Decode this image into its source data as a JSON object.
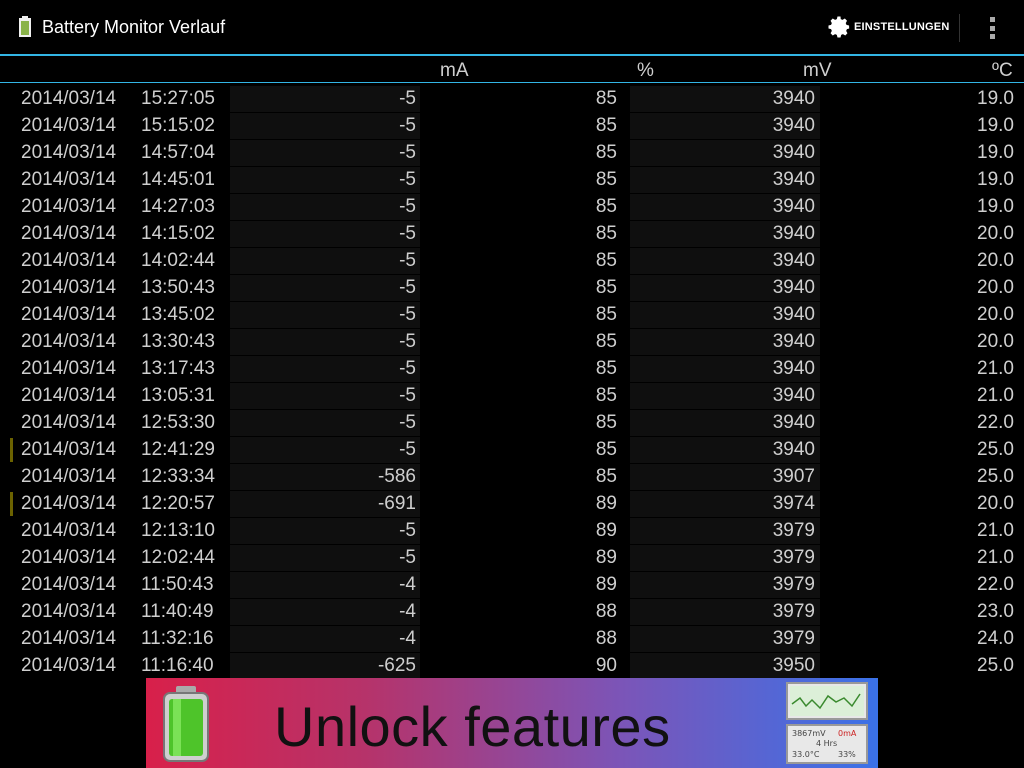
{
  "app": {
    "title": "Battery Monitor Verlauf"
  },
  "actionbar": {
    "settings_label": "EINSTELLUNGEN",
    "settings_icon": "gear-icon",
    "overflow_icon": "overflow-menu-icon"
  },
  "columns": {
    "ma": "mA",
    "percent": "%",
    "mv": "mV",
    "temp": "ºC"
  },
  "rows": [
    {
      "date": "2014/03/14",
      "time": "15:27:05",
      "ma": "-5",
      "percent": "85",
      "mv": "3940",
      "temp": "19.0",
      "marker": false
    },
    {
      "date": "2014/03/14",
      "time": "15:15:02",
      "ma": "-5",
      "percent": "85",
      "mv": "3940",
      "temp": "19.0",
      "marker": false
    },
    {
      "date": "2014/03/14",
      "time": "14:57:04",
      "ma": "-5",
      "percent": "85",
      "mv": "3940",
      "temp": "19.0",
      "marker": false
    },
    {
      "date": "2014/03/14",
      "time": "14:45:01",
      "ma": "-5",
      "percent": "85",
      "mv": "3940",
      "temp": "19.0",
      "marker": false
    },
    {
      "date": "2014/03/14",
      "time": "14:27:03",
      "ma": "-5",
      "percent": "85",
      "mv": "3940",
      "temp": "19.0",
      "marker": false
    },
    {
      "date": "2014/03/14",
      "time": "14:15:02",
      "ma": "-5",
      "percent": "85",
      "mv": "3940",
      "temp": "20.0",
      "marker": false
    },
    {
      "date": "2014/03/14",
      "time": "14:02:44",
      "ma": "-5",
      "percent": "85",
      "mv": "3940",
      "temp": "20.0",
      "marker": false
    },
    {
      "date": "2014/03/14",
      "time": "13:50:43",
      "ma": "-5",
      "percent": "85",
      "mv": "3940",
      "temp": "20.0",
      "marker": false
    },
    {
      "date": "2014/03/14",
      "time": "13:45:02",
      "ma": "-5",
      "percent": "85",
      "mv": "3940",
      "temp": "20.0",
      "marker": false
    },
    {
      "date": "2014/03/14",
      "time": "13:30:43",
      "ma": "-5",
      "percent": "85",
      "mv": "3940",
      "temp": "20.0",
      "marker": false
    },
    {
      "date": "2014/03/14",
      "time": "13:17:43",
      "ma": "-5",
      "percent": "85",
      "mv": "3940",
      "temp": "21.0",
      "marker": false
    },
    {
      "date": "2014/03/14",
      "time": "13:05:31",
      "ma": "-5",
      "percent": "85",
      "mv": "3940",
      "temp": "21.0",
      "marker": false
    },
    {
      "date": "2014/03/14",
      "time": "12:53:30",
      "ma": "-5",
      "percent": "85",
      "mv": "3940",
      "temp": "22.0",
      "marker": false
    },
    {
      "date": "2014/03/14",
      "time": "12:41:29",
      "ma": "-5",
      "percent": "85",
      "mv": "3940",
      "temp": "25.0",
      "marker": true
    },
    {
      "date": "2014/03/14",
      "time": "12:33:34",
      "ma": "-586",
      "percent": "85",
      "mv": "3907",
      "temp": "25.0",
      "marker": false
    },
    {
      "date": "2014/03/14",
      "time": "12:20:57",
      "ma": "-691",
      "percent": "89",
      "mv": "3974",
      "temp": "20.0",
      "marker": true
    },
    {
      "date": "2014/03/14",
      "time": "12:13:10",
      "ma": "-5",
      "percent": "89",
      "mv": "3979",
      "temp": "21.0",
      "marker": false
    },
    {
      "date": "2014/03/14",
      "time": "12:02:44",
      "ma": "-5",
      "percent": "89",
      "mv": "3979",
      "temp": "21.0",
      "marker": false
    },
    {
      "date": "2014/03/14",
      "time": "11:50:43",
      "ma": "-4",
      "percent": "89",
      "mv": "3979",
      "temp": "22.0",
      "marker": false
    },
    {
      "date": "2014/03/14",
      "time": "11:40:49",
      "ma": "-4",
      "percent": "88",
      "mv": "3979",
      "temp": "23.0",
      "marker": false
    },
    {
      "date": "2014/03/14",
      "time": "11:32:16",
      "ma": "-4",
      "percent": "88",
      "mv": "3979",
      "temp": "24.0",
      "marker": false
    },
    {
      "date": "2014/03/14",
      "time": "11:16:40",
      "ma": "-625",
      "percent": "90",
      "mv": "3950",
      "temp": "25.0",
      "marker": false
    }
  ],
  "banner": {
    "text": "Unlock features",
    "battery_icon": "battery-charging-icon",
    "thumb1_icon": "graph-thumbnail-icon",
    "thumb2": {
      "line1_left": "3867mV",
      "line1_right": "0mA",
      "line2": "4 Hrs",
      "line3_left": "33.0°C",
      "line3_right": "33%"
    },
    "colors": {
      "start": "#d8204a",
      "end": "#3a72e8"
    }
  },
  "colors": {
    "accent": "#33b5e5",
    "marker": "#6b6200",
    "background": "#000000"
  }
}
